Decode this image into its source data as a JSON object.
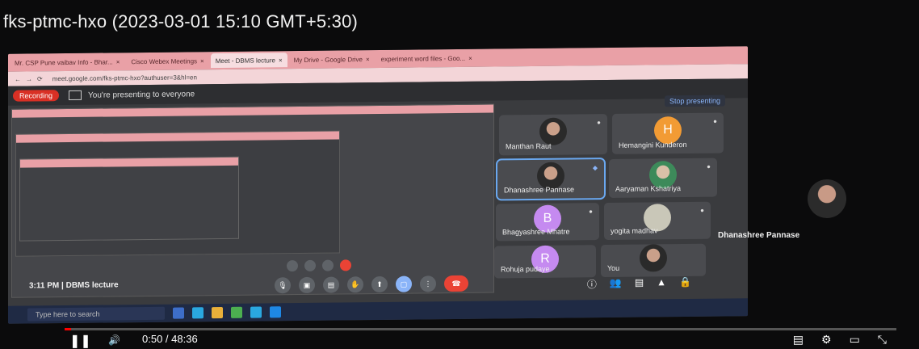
{
  "video": {
    "title": "fks-ptmc-hxo (2023-03-01 15:10 GMT+5:30)",
    "time_display": "0:50 / 48:36"
  },
  "browser": {
    "tabs": [
      {
        "label": "Mr. CSP Pune vaibav Info - Bhar..."
      },
      {
        "label": "Cisco Webex Meetings"
      },
      {
        "label": "Meet - DBMS lecture"
      },
      {
        "label": "My Drive - Google Drive"
      },
      {
        "label": "experiment word files - Goo..."
      }
    ],
    "url": "meet.google.com/fks-ptmc-hxo?authuser=3&hl=en"
  },
  "meet": {
    "recording_label": "Recording",
    "presenting_text": "You're presenting to everyone",
    "stop_presenting": "Stop presenting",
    "status": "3:11 PM | DBMS lecture",
    "participants": [
      {
        "name": "Manthan Raut",
        "avatar": "photo"
      },
      {
        "name": "Hemangini Kunderon",
        "avatar": "H"
      },
      {
        "name": "Dhanashree Pannase",
        "avatar": "photo"
      },
      {
        "name": "Aaryaman Kshatriya",
        "avatar": "photo"
      },
      {
        "name": "Bhagyashree Mhatre",
        "avatar": "B"
      },
      {
        "name": "yogita madhav",
        "avatar": "yogita"
      },
      {
        "name": "Rohuja pudaye",
        "avatar": "R"
      },
      {
        "name": "You",
        "avatar": "photo"
      }
    ]
  },
  "taskbar": {
    "search_placeholder": "Type here to search"
  },
  "side_panel": {
    "name": "Dhanashree Pannase"
  }
}
